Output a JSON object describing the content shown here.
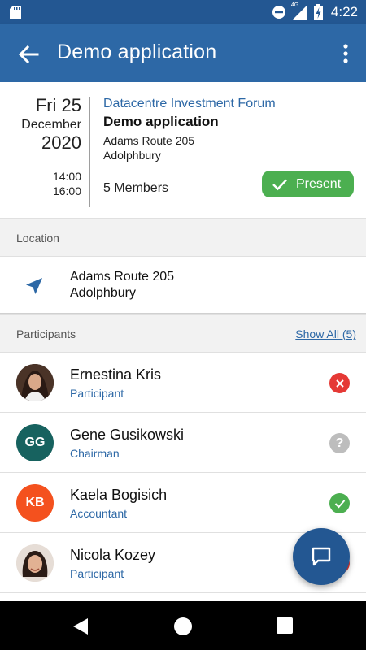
{
  "status_bar": {
    "time": "4:22",
    "network_label": "4G",
    "icons": [
      "sd-card-icon",
      "do-not-disturb-icon",
      "signal-icon",
      "battery-charging-icon"
    ]
  },
  "app_bar": {
    "title": "Demo application",
    "back_icon": "arrow-left-icon",
    "more_icon": "more-vertical-icon"
  },
  "event": {
    "day": "Fri 25",
    "month": "December",
    "year": "2020",
    "time_start": "14:00",
    "time_end": "16:00",
    "forum": "Datacentre Investment Forum",
    "name": "Demo application",
    "street": "Adams Route 205",
    "city": "Adolphbury",
    "members": "5 Members",
    "attendance_label": "Present"
  },
  "location_section": {
    "title": "Location",
    "street": "Adams Route 205",
    "city": "Adolphbury",
    "icon": "navigation-arrow-icon"
  },
  "participants_section": {
    "title": "Participants",
    "show_all": "Show All (5)",
    "items": [
      {
        "name": "Ernestina Kris",
        "role": "Participant",
        "initials": "",
        "avatar": "photo",
        "status": "declined"
      },
      {
        "name": "Gene Gusikowski",
        "role": "Chairman",
        "initials": "GG",
        "avatar": "initials",
        "status": "unknown"
      },
      {
        "name": "Kaela Bogisich",
        "role": "Accountant",
        "initials": "KB",
        "avatar": "initials",
        "status": "accepted"
      },
      {
        "name": "Nicola Kozey",
        "role": "Participant",
        "initials": "",
        "avatar": "photo",
        "status": "declined"
      }
    ]
  },
  "colors": {
    "primary": "#2d68a6",
    "primary_dark": "#235792",
    "success": "#4caf50",
    "danger": "#e53935",
    "unknown": "#bdbdbd",
    "avatar_gg": "#17625f",
    "avatar_kb": "#f4511e"
  },
  "fab": {
    "icon": "chat-message-icon"
  },
  "nav_bar": {
    "icons": [
      "nav-back-icon",
      "nav-home-icon",
      "nav-recents-icon"
    ]
  }
}
